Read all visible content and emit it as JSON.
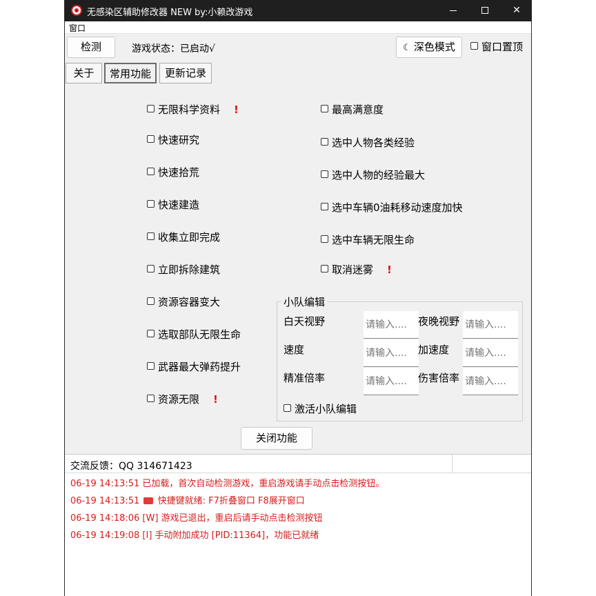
{
  "window": {
    "title": "无感染区辅助修改器 NEW   by:小赖改游戏"
  },
  "menubar": {
    "menu": "窗口"
  },
  "toolbar": {
    "detect_button": "检测",
    "status_label": "游戏状态：已启动√",
    "dark_mode_button": "深色模式",
    "pin_label": "窗口置顶"
  },
  "tabs": [
    {
      "label": "关于"
    },
    {
      "label": "常用功能"
    },
    {
      "label": "更新记录"
    }
  ],
  "left_options": [
    {
      "label": "无限科学资料",
      "warn": "!"
    },
    {
      "label": "快速研究"
    },
    {
      "label": "快速拾荒"
    },
    {
      "label": "快速建造"
    },
    {
      "label": "收集立即完成"
    },
    {
      "label": "立即拆除建筑"
    },
    {
      "label": "资源容器变大"
    },
    {
      "label": "选取部队无限生命"
    },
    {
      "label": "武器最大弹药提升"
    },
    {
      "label": "资源无限",
      "warn": "!"
    }
  ],
  "right_options": [
    {
      "label": "最高满意度"
    },
    {
      "label": "选中人物各类经验"
    },
    {
      "label": "选中人物的经验最大"
    },
    {
      "label": "选中车辆0油耗移动速度加快"
    },
    {
      "label": "选中车辆无限生命"
    },
    {
      "label": "取消迷雾",
      "warn": "!"
    }
  ],
  "squad": {
    "title": "小队编辑",
    "day_vision": "白天视野",
    "night_vision": "夜晚视野",
    "speed": "速度",
    "acceleration": "加速度",
    "accuracy": "精准倍率",
    "damage": "伤害倍率",
    "placeholder": "请输入....",
    "activate": "激活小队编辑"
  },
  "close_button": "关闭功能",
  "feedback": "交流反馈：QQ 314671423",
  "log": [
    "06-19 14:13:51 已加载，首次自动检测游戏，重启游戏请手动点击检测按钮。",
    "06-19 14:13:51 ",
    "快捷键就绪: F7折叠窗口  F8展开窗口",
    "06-19 14:18:06 [W] 游戏已退出，重启后请手动点击检测按钮",
    "06-19 14:19:08 [I] 手动附加成功 [PID:11364]，功能已就绪"
  ],
  "colors": {
    "log_text": "#d61c1c",
    "warn": "#e01010",
    "titlebar": "#1f1f1f"
  }
}
